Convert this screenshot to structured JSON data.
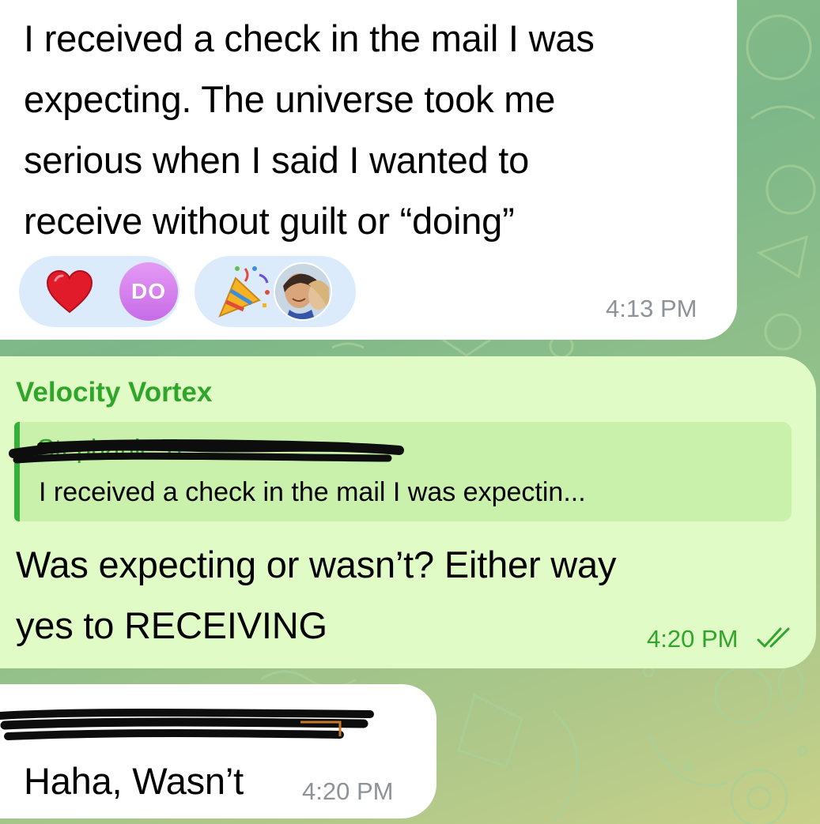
{
  "messages": [
    {
      "direction": "incoming",
      "text_lines": [
        "I received a check in the mail I was",
        "expecting. The universe took me",
        "serious when I said I wanted to",
        "receive without guilt or “doing”"
      ],
      "time": "4:13 PM",
      "reactions": [
        {
          "icon": "heart-icon",
          "avatar_initials": "DO",
          "avatar_color": "#d97ff0"
        },
        {
          "icon": "party-popper-icon",
          "avatar": "photo-avatar"
        }
      ]
    },
    {
      "direction": "outgoing",
      "sender": "Velocity Vortex",
      "reply": {
        "author": "Stephanie Tr",
        "text": "I received a check in the mail I was expectin..."
      },
      "text_lines": [
        "Was expecting or wasn’t? Either way",
        "yes to RECEIVING"
      ],
      "time": "4:20 PM",
      "status_icon": "double-check-icon"
    },
    {
      "direction": "incoming",
      "text": "Haha, Wasn’t",
      "time": "4:20 PM"
    }
  ],
  "colors": {
    "incoming_bubble": "#ffffff",
    "outgoing_bubble": "#e1fbc6",
    "accent_green": "#2fa52a",
    "reaction_bg": "#dcebfb",
    "time_gray": "#8e9299"
  }
}
